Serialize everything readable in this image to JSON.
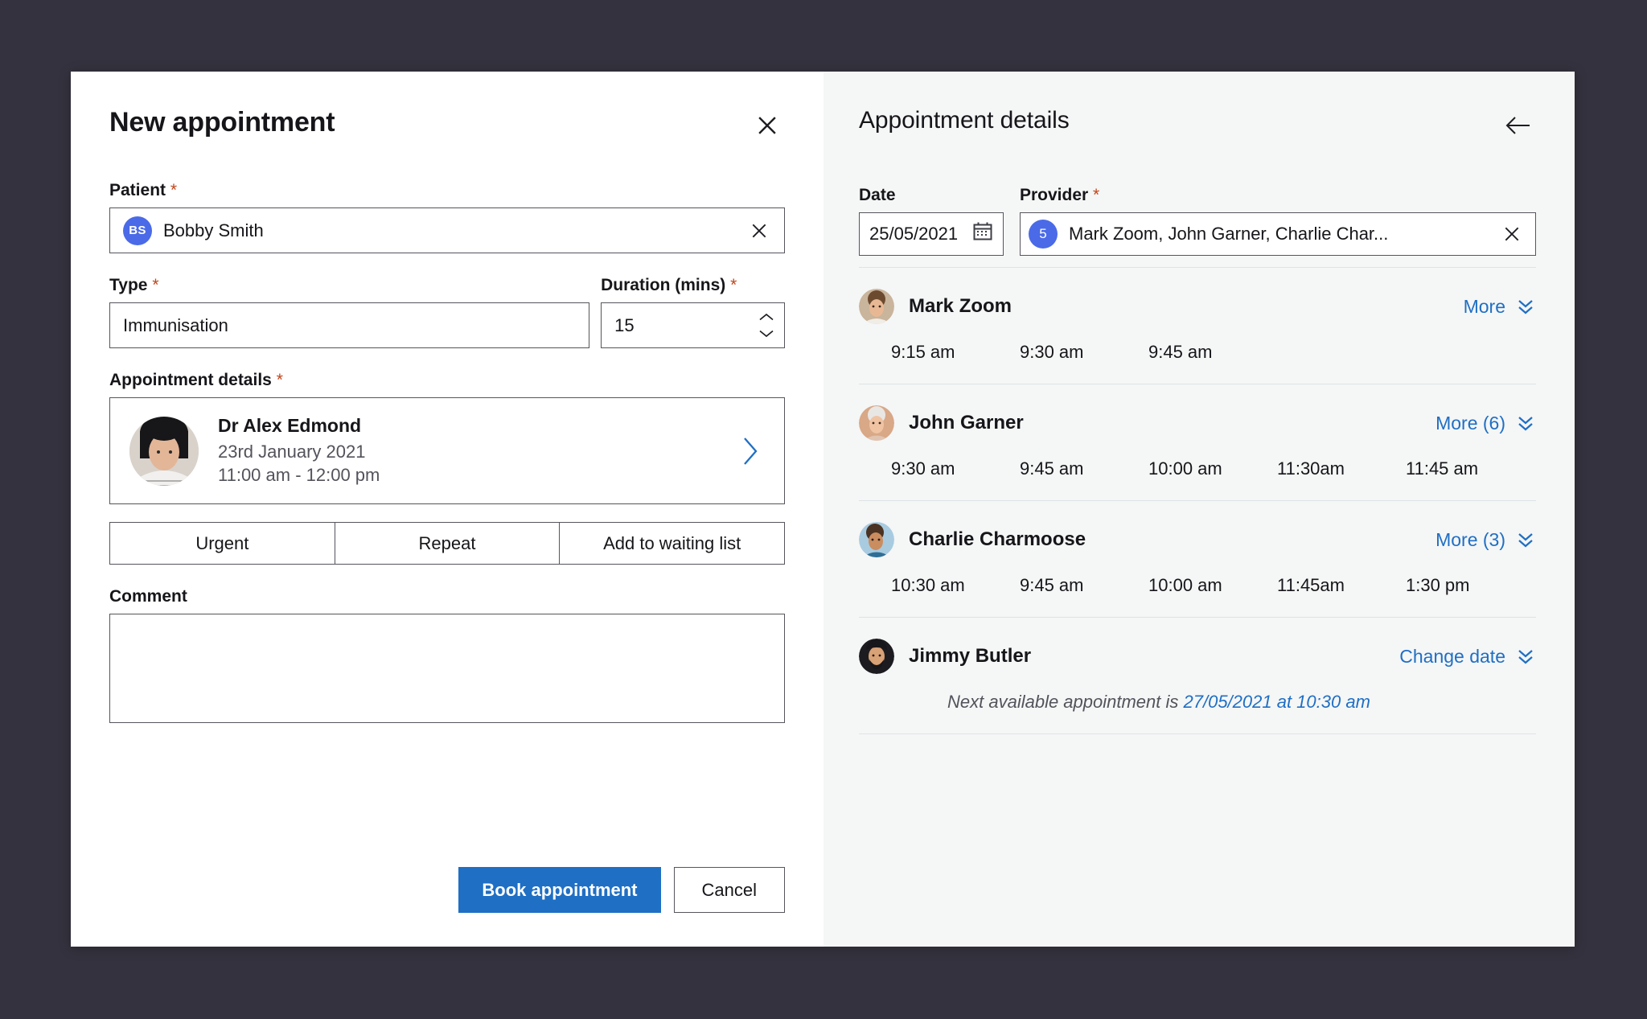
{
  "left": {
    "title": "New appointment",
    "close_icon": "close-icon",
    "patient": {
      "label": "Patient",
      "required": "*",
      "initials": "BS",
      "value": "Bobby Smith",
      "clear_icon": "close-icon"
    },
    "type": {
      "label": "Type",
      "required": "*",
      "value": "Immunisation"
    },
    "duration": {
      "label": "Duration (mins)",
      "required": "*",
      "value": "15"
    },
    "appointment_details": {
      "label": "Appointment details",
      "required": "*",
      "provider_name": "Dr Alex Edmond",
      "date": "23rd January 2021",
      "time_range": "11:00 am - 12:00 pm",
      "chevron_icon": "chevron-right-icon"
    },
    "toggles": [
      {
        "label": "Urgent"
      },
      {
        "label": "Repeat"
      },
      {
        "label": "Add to waiting list"
      }
    ],
    "comment": {
      "label": "Comment",
      "value": "",
      "placeholder": ""
    },
    "actions": {
      "primary": "Book appointment",
      "secondary": "Cancel"
    }
  },
  "right": {
    "title": "Appointment details",
    "back_icon": "arrow-left-icon",
    "date": {
      "label": "Date",
      "value": "25/05/2021",
      "calendar_icon": "calendar-icon"
    },
    "provider": {
      "label": "Provider",
      "required": "*",
      "count": "5",
      "value": "Mark Zoom, John Garner, Charlie Char...",
      "clear_icon": "close-icon"
    },
    "providers": [
      {
        "name": "Mark Zoom",
        "action_label": "More",
        "action_icon": "chevron-double-down-icon",
        "slots": [
          "9:15 am",
          "9:30 am",
          "9:45 am"
        ]
      },
      {
        "name": "John Garner",
        "action_label": "More (6)",
        "action_icon": "chevron-double-down-icon",
        "slots": [
          "9:30 am",
          "9:45 am",
          "10:00 am",
          "11:30am",
          "11:45 am"
        ]
      },
      {
        "name": "Charlie Charmoose",
        "action_label": "More (3)",
        "action_icon": "chevron-double-down-icon",
        "slots": [
          "10:30 am",
          "9:45 am",
          "10:00 am",
          "11:45am",
          "1:30 pm"
        ]
      },
      {
        "name": "Jimmy Butler",
        "action_label": "Change date",
        "action_icon": "chevron-double-down-icon",
        "slots": [],
        "next_available_prefix": "Next available appointment is ",
        "next_available_value": "27/05/2021 at 10:30 am"
      }
    ]
  },
  "colors": {
    "backdrop": "#34323e",
    "primary_blue": "#1f6fc4",
    "avatar_blue": "#4a6ae8",
    "required_star": "#c0451b",
    "panel_bg": "#f5f6f6",
    "border": "#55555c",
    "divider": "#dfe3e6"
  }
}
